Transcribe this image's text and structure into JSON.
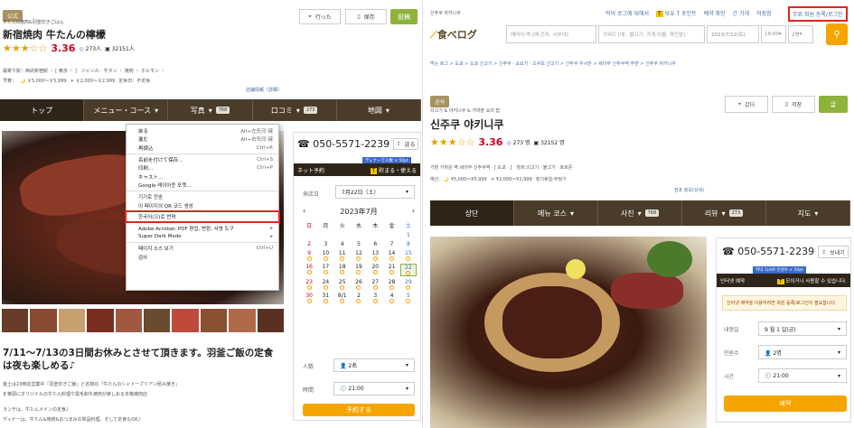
{
  "left": {
    "badge": "公式",
    "subtitle": "牛たん&焼肉&羽釜炊きごはん",
    "name": "新宿焼肉 牛たんの檸檬",
    "score": "3.36",
    "reviews": "273",
    "reviews_unit": "人",
    "saves": "32151",
    "saves_unit": "人",
    "info_line1": "最寄り駅：西武新宿駅 ・ [ 東京 ・ ]　ジャンル：牛タン ・ 焼肉 ・ ホルモン ・",
    "info_line2_label": "予算：",
    "dinner_budget": "￥5,000～￥5,999",
    "lunch_budget": "￥2,000～￥2,999",
    "closed": "定休日：不定休",
    "store_info_link": "店舗情報（詳細）",
    "went_label": "行った",
    "save_label": "保存",
    "post_label": "投稿",
    "tabs": [
      {
        "label": "トップ",
        "count": ""
      },
      {
        "label": "メニュー・コース",
        "count": ""
      },
      {
        "label": "写真",
        "count": "768"
      },
      {
        "label": "口コミ",
        "count": "273"
      },
      {
        "label": "地図",
        "count": ""
      }
    ],
    "phone": "050-5571-2239",
    "share_label": "送る",
    "tpoint_tag": "ディナーで人数 × 50pt",
    "net_reserve": "ネット予約",
    "tpoint_label": "貯まる・使える",
    "visit_date_label": "来店日",
    "visit_date_value": "7月22日（土）",
    "cal_month": "2023年7月",
    "weekdays": [
      "日",
      "月",
      "火",
      "水",
      "木",
      "金",
      "土"
    ],
    "cal_rows": [
      [
        "",
        "",
        "",
        "",
        "",
        "",
        "1"
      ],
      [
        "2",
        "3",
        "4",
        "5",
        "6",
        "7",
        "8"
      ],
      [
        "9",
        "10",
        "11",
        "12",
        "13",
        "14",
        "15"
      ],
      [
        "16",
        "17",
        "18",
        "19",
        "20",
        "21",
        "22"
      ],
      [
        "23",
        "24",
        "25",
        "26",
        "27",
        "28",
        "29"
      ],
      [
        "30",
        "31",
        "8/1",
        "2",
        "3",
        "4",
        "5"
      ]
    ],
    "people_label": "人数",
    "people_value": "2名",
    "time_label": "時間",
    "time_value": "21:00",
    "reserve_button": "予約する",
    "headline": "7/11～7/13の3日間お休みとさせて頂きます。羽釜ご飯の定食は夜も楽しめる♪",
    "body": [
      "金土は23時迄営業中『羽釜炊きご飯』と名物の『牛たんのシャトーブリアン極み焼き』",
      "を筆頭にオリジナルの牛たん料理や黒毛和牛焼肉が楽しめる本格焼肉店",
      "ランチは、牛たんメインの定食♪",
      "ディナーは、牛たん&焼肉&おつまみの単品料理。そして定食もOK♪"
    ],
    "context_menu": [
      {
        "label": "戻る",
        "shortcut": "Alt+左矢印 键",
        "sep_after": false
      },
      {
        "label": "進む",
        "shortcut": "Alt+右矢印 键",
        "sep_after": false
      },
      {
        "label": "再読込",
        "shortcut": "Ctrl+R",
        "sep_after": true
      },
      {
        "label": "名前を付けて保存...",
        "shortcut": "Ctrl+S",
        "sep_after": false
      },
      {
        "label": "印刷...",
        "shortcut": "Ctrl+P",
        "sep_after": false
      },
      {
        "label": "キャスト...",
        "shortcut": "",
        "sep_after": false
      },
      {
        "label": "Google 레이아웃 포켓...",
        "shortcut": "",
        "sep_after": true
      },
      {
        "label": "기기로 전송",
        "shortcut": "",
        "sep_after": false
      },
      {
        "label": "이 페이지의 QR 코드 생성",
        "shortcut": "",
        "sep_after": true
      },
      {
        "label": "한국어(으)로 번역",
        "shortcut": "",
        "sep_after": true
      },
      {
        "label": "Adobe Acrobat: PDF 편집, 변환, 서명 도구",
        "shortcut": "▸",
        "sep_after": false
      },
      {
        "label": "Super Dark Mode",
        "shortcut": "▸",
        "sep_after": true
      },
      {
        "label": "페이지 소스 보기",
        "shortcut": "Ctrl+U",
        "sep_after": false
      },
      {
        "label": "검사",
        "shortcut": "",
        "sep_after": false
      }
    ]
  },
  "right": {
    "breadcrumb_small": "신주쿠 야키니쿠",
    "top_links": [
      "먹어 로그에 대해서",
      "보유 T 포인트",
      "예약 확인",
      "간 가게",
      "저장함"
    ],
    "register_link": "무료 회원 등록/로그인",
    "logo": "食べログ",
    "search_area_ph": "에리어·역 [예:긴자, 시부야]",
    "search_kw_ph": "키워드 [예 : 불고기, 가게 이름, 개인앞]",
    "date_value": "2023/7/22(토)",
    "time_value": "19:00",
    "people_value": "2명",
    "breadcrumb": "먹는 로그 > 도쿄 > 도쿄 신고기 > 신주쿠 · 요요기 · 오쿠보 신고기 > 신주쿠 우시반 > 세이부 신주쿠역 주변 > 신주쿠 야키니쿠",
    "badge": "공식",
    "subtitle": "쇠고기 & 야키니쿠 & 가마솥 요리 밥",
    "name": "신주쿠 야키니쿠",
    "score": "3.36",
    "reviews": "273",
    "reviews_unit": "명",
    "saves": "32152",
    "saves_unit": "명",
    "went_label": "갔다",
    "save_label": "저장",
    "post_label": "글",
    "info_line1": "가장 가까운 역:세이부 신주쿠역 · [ 도쿄 · ]　장르:쇠고기 · 불고기 · 호르몬 ·",
    "budget_label": "예산:",
    "dinner_budget": "¥5,000～¥5,999",
    "lunch_budget": "¥2,000～¥2,999",
    "closed": "정기휴일:부정기",
    "store_info_link": "점포 정보(상세)",
    "tabs": [
      {
        "label": "상단",
        "count": ""
      },
      {
        "label": "메뉴 코스",
        "count": ""
      },
      {
        "label": "사진",
        "count": "768"
      },
      {
        "label": "리뷰",
        "count": "273"
      },
      {
        "label": "지도",
        "count": ""
      }
    ],
    "phone": "050-5571-2239",
    "share_label": "보내기",
    "tpoint_tag": "저녁 식사로 인원수 × 50pt",
    "net_reserve": "인터넷 예약",
    "tpoint_label": "모이거나 사용할 수 있습니다.",
    "notice": "인터넷 예약을 이용하려면 회원 등록/로그인이 필요합니다.",
    "visit_label": "내점일",
    "visit_value": "9 월 1 일(금)",
    "people_label": "인원수",
    "people_sel": "2명",
    "time_label": "시간",
    "time_sel": "21:00",
    "reserve_button": "예약"
  }
}
